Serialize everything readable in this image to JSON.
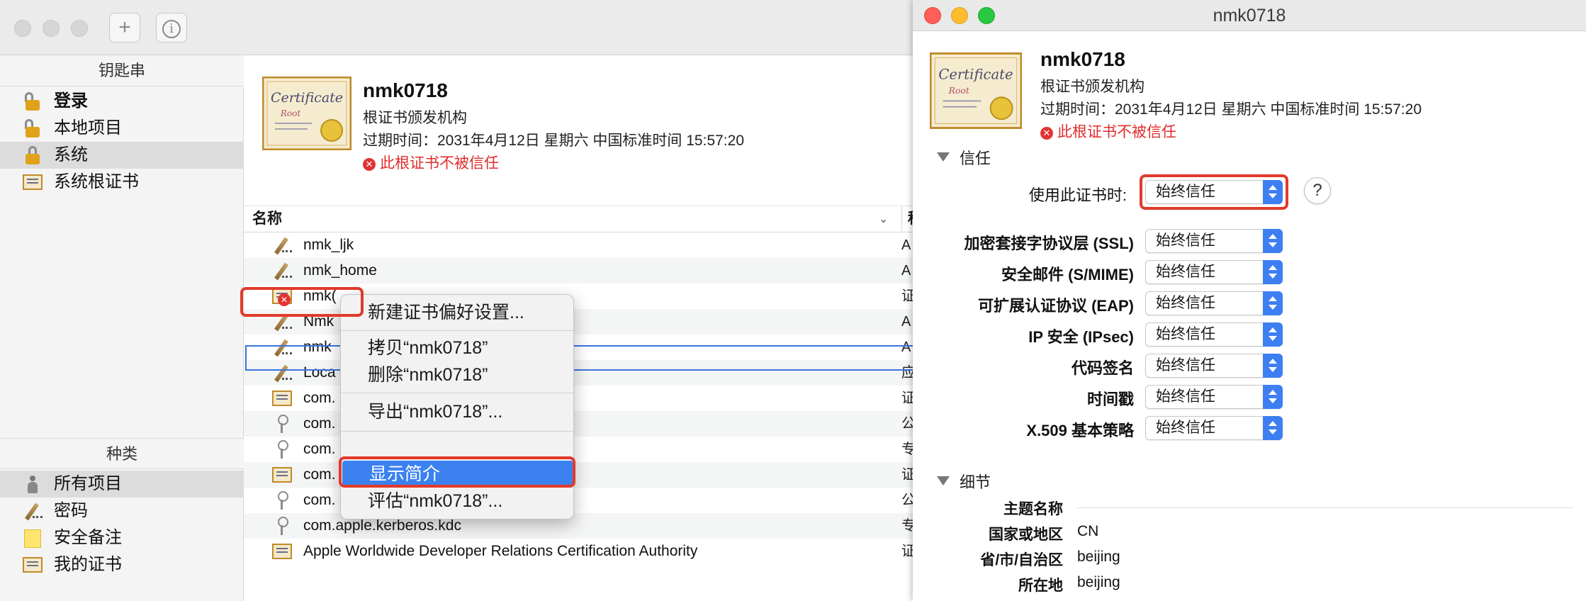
{
  "keychain": {
    "sidebar": {
      "keychains_header": "钥匙串",
      "keychains": [
        {
          "label": "登录",
          "bold": true
        },
        {
          "label": "本地项目"
        },
        {
          "label": "系统",
          "selected": true
        },
        {
          "label": "系统根证书"
        }
      ],
      "category_header": "种类",
      "categories": [
        {
          "label": "所有项目",
          "selected": true
        },
        {
          "label": "密码"
        },
        {
          "label": "安全备注"
        },
        {
          "label": "我的证书"
        }
      ]
    },
    "summary": {
      "cert_word": "Certificate",
      "cert_sub": "Root",
      "name": "nmk0718",
      "type": "根证书颁发机构",
      "expires": "过期时间：2031年4月12日 星期六 中国标准时间 15:57:20",
      "error_glyph": "✕",
      "error": "此根证书不被信任"
    },
    "list": {
      "col_name": "名称",
      "col_kind": "种",
      "rows": [
        {
          "name": "nmk_ljk",
          "kind": "A",
          "icon": "pen-icon"
        },
        {
          "name": "nmk_home",
          "kind": "A",
          "icon": "pen-icon"
        },
        {
          "name": "nmk(",
          "kind": "证",
          "icon": "cert-error-icon"
        },
        {
          "name": "Nmk",
          "kind": "A",
          "icon": "pen-icon"
        },
        {
          "name": "nmk",
          "kind": "A",
          "icon": "pen-icon"
        },
        {
          "name": "Loca",
          "kind": "应",
          "icon": "pen-icon"
        },
        {
          "name": "com.",
          "kind": "证",
          "icon": "cert-icon"
        },
        {
          "name": "com.",
          "kind": "公",
          "icon": "key-icon"
        },
        {
          "name": "com.",
          "kind": "专",
          "icon": "key-icon"
        },
        {
          "name": "com.",
          "kind": "证",
          "icon": "cert-icon"
        },
        {
          "name": "com.",
          "kind": "公",
          "icon": "key-icon"
        },
        {
          "name": "com.apple.kerberos.kdc",
          "kind": "专",
          "icon": "key-icon"
        },
        {
          "name": "Apple Worldwide Developer Relations Certification Authority",
          "kind": "证",
          "icon": "cert-icon"
        }
      ]
    },
    "context_menu": {
      "items": [
        "新建证书偏好设置...",
        "拷贝“nmk0718”",
        "删除“nmk0718”",
        "导出“nmk0718”...",
        "显示简介",
        "评估“nmk0718”..."
      ],
      "highlighted": "显示简介"
    }
  },
  "info_window": {
    "title": "nmk0718",
    "summary": {
      "cert_word": "Certificate",
      "cert_sub": "Root",
      "name": "nmk0718",
      "type": "根证书颁发机构",
      "expires": "过期时间：2031年4月12日 星期六 中国标准时间 15:57:20",
      "error_glyph": "✕",
      "error": "此根证书不被信任"
    },
    "trust": {
      "section": "信任",
      "when_using_label": "使用此证书时:",
      "when_using_value": "始终信任",
      "help": "?",
      "policies": [
        {
          "label": "加密套接字协议层 (SSL)",
          "value": "始终信任"
        },
        {
          "label": "安全邮件 (S/MIME)",
          "value": "始终信任"
        },
        {
          "label": "可扩展认证协议 (EAP)",
          "value": "始终信任"
        },
        {
          "label": "IP 安全 (IPsec)",
          "value": "始终信任"
        },
        {
          "label": "代码签名",
          "value": "始终信任"
        },
        {
          "label": "时间戳",
          "value": "始终信任"
        },
        {
          "label": "X.509 基本策略",
          "value": "始终信任"
        }
      ]
    },
    "details": {
      "section": "细节",
      "subject_name": "主题名称",
      "fields": [
        {
          "label": "国家或地区",
          "value": "CN"
        },
        {
          "label": "省/市/自治区",
          "value": "beijing"
        },
        {
          "label": "所在地",
          "value": "beijing"
        }
      ]
    }
  },
  "colors": {
    "accent": "#3b82f0",
    "error": "#e22b2b",
    "annotation": "#e23a2a"
  }
}
